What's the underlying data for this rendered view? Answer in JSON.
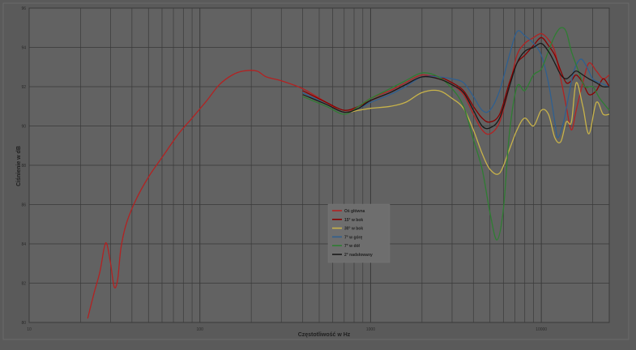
{
  "chart_data": {
    "type": "line",
    "xlabel": "Częstotliwość w Hz",
    "ylabel": "Ciśnienie w dB",
    "x_scale": "log",
    "xlim": [
      10,
      25000
    ],
    "ylim": [
      80,
      96
    ],
    "x_ticks": [
      10,
      100,
      1000,
      10000
    ],
    "x_tick_labels": [
      "10",
      "100",
      "1000",
      "10000"
    ],
    "y_ticks": [
      80,
      82,
      84,
      86,
      88,
      90,
      92,
      94,
      96
    ],
    "y_tick_labels": [
      "80",
      "82",
      "84",
      "86",
      "88",
      "90",
      "92",
      "94",
      "96"
    ],
    "grid": true,
    "legend_position": "center",
    "series": [
      {
        "name": "Oś główna",
        "color": "#b22222",
        "points": [
          [
            22,
            80.2
          ],
          [
            24,
            81.5
          ],
          [
            26,
            82.6
          ],
          [
            27.5,
            83.8
          ],
          [
            28.5,
            84.0
          ],
          [
            30,
            83.0
          ],
          [
            31.5,
            81.8
          ],
          [
            33,
            82.2
          ],
          [
            34.5,
            83.8
          ],
          [
            37,
            85.0
          ],
          [
            42,
            86.2
          ],
          [
            50,
            87.4
          ],
          [
            60,
            88.4
          ],
          [
            75,
            89.6
          ],
          [
            90,
            90.4
          ],
          [
            110,
            91.3
          ],
          [
            130,
            92.1
          ],
          [
            155,
            92.6
          ],
          [
            180,
            92.8
          ],
          [
            215,
            92.8
          ],
          [
            245,
            92.5
          ],
          [
            300,
            92.3
          ],
          [
            400,
            91.9
          ],
          [
            550,
            91.2
          ],
          [
            700,
            90.7
          ],
          [
            850,
            91.0
          ],
          [
            1000,
            91.4
          ],
          [
            1300,
            91.8
          ],
          [
            1600,
            92.2
          ],
          [
            2000,
            92.6
          ],
          [
            2500,
            92.4
          ],
          [
            3000,
            92.1
          ],
          [
            3500,
            91.6
          ],
          [
            4000,
            90.6
          ],
          [
            4500,
            89.8
          ],
          [
            5000,
            89.6
          ],
          [
            5700,
            90.2
          ],
          [
            6500,
            92.0
          ],
          [
            7200,
            93.6
          ],
          [
            8000,
            94.2
          ],
          [
            9000,
            94.5
          ],
          [
            10000,
            94.7
          ],
          [
            11000,
            94.4
          ],
          [
            12000,
            93.8
          ],
          [
            13000,
            92.4
          ],
          [
            14000,
            91.0
          ],
          [
            15000,
            89.8
          ],
          [
            16000,
            90.8
          ],
          [
            17500,
            92.2
          ],
          [
            19000,
            93.2
          ],
          [
            21000,
            92.8
          ],
          [
            23000,
            92.4
          ],
          [
            25000,
            92.6
          ]
        ]
      },
      {
        "name": "15° w bok",
        "color": "#8b0000",
        "points": [
          [
            400,
            91.8
          ],
          [
            550,
            91.2
          ],
          [
            700,
            90.8
          ],
          [
            850,
            91.0
          ],
          [
            1000,
            91.3
          ],
          [
            1300,
            91.7
          ],
          [
            1600,
            92.1
          ],
          [
            2000,
            92.5
          ],
          [
            2500,
            92.5
          ],
          [
            3000,
            92.2
          ],
          [
            3500,
            91.8
          ],
          [
            4000,
            91.0
          ],
          [
            4500,
            90.4
          ],
          [
            5000,
            90.2
          ],
          [
            5700,
            90.6
          ],
          [
            6500,
            92.2
          ],
          [
            7200,
            93.2
          ],
          [
            8000,
            93.6
          ],
          [
            9000,
            94.1
          ],
          [
            10000,
            94.5
          ],
          [
            11000,
            94.1
          ],
          [
            12000,
            93.6
          ],
          [
            13000,
            92.8
          ],
          [
            14000,
            92.2
          ],
          [
            15000,
            92.3
          ],
          [
            16000,
            92.6
          ],
          [
            17500,
            92.2
          ],
          [
            19000,
            91.6
          ],
          [
            21000,
            91.8
          ],
          [
            23000,
            92.4
          ],
          [
            25000,
            92.0
          ]
        ]
      },
      {
        "name": "30° w bok",
        "color": "#c8b34a",
        "points": [
          [
            400,
            91.6
          ],
          [
            550,
            91.1
          ],
          [
            700,
            90.7
          ],
          [
            850,
            90.8
          ],
          [
            1000,
            90.9
          ],
          [
            1300,
            91.0
          ],
          [
            1600,
            91.2
          ],
          [
            2000,
            91.7
          ],
          [
            2500,
            91.8
          ],
          [
            3000,
            91.4
          ],
          [
            3500,
            90.9
          ],
          [
            4000,
            89.8
          ],
          [
            4500,
            88.6
          ],
          [
            5000,
            87.8
          ],
          [
            5700,
            87.6
          ],
          [
            6500,
            88.8
          ],
          [
            7200,
            89.8
          ],
          [
            8000,
            90.4
          ],
          [
            9000,
            90.0
          ],
          [
            10000,
            90.8
          ],
          [
            11000,
            90.6
          ],
          [
            12000,
            89.4
          ],
          [
            13000,
            89.2
          ],
          [
            14000,
            90.2
          ],
          [
            15000,
            90.2
          ],
          [
            16000,
            92.2
          ],
          [
            17500,
            91.0
          ],
          [
            19000,
            89.6
          ],
          [
            21000,
            91.2
          ],
          [
            23000,
            90.6
          ],
          [
            25000,
            90.6
          ]
        ]
      },
      {
        "name": "7° w górę",
        "color": "#2f5f8f",
        "points": [
          [
            400,
            91.7
          ],
          [
            550,
            91.1
          ],
          [
            700,
            90.7
          ],
          [
            850,
            90.9
          ],
          [
            1000,
            91.2
          ],
          [
            1300,
            91.6
          ],
          [
            1600,
            92.0
          ],
          [
            2000,
            92.5
          ],
          [
            2500,
            92.5
          ],
          [
            3000,
            92.4
          ],
          [
            3500,
            92.2
          ],
          [
            4000,
            91.5
          ],
          [
            4500,
            90.8
          ],
          [
            5000,
            90.8
          ],
          [
            5700,
            91.8
          ],
          [
            6500,
            93.6
          ],
          [
            7200,
            94.8
          ],
          [
            8000,
            94.6
          ],
          [
            9000,
            94.2
          ],
          [
            10000,
            93.6
          ],
          [
            11000,
            92.2
          ],
          [
            12000,
            90.2
          ],
          [
            12500,
            89.4
          ],
          [
            13500,
            90.2
          ],
          [
            14500,
            91.6
          ],
          [
            15500,
            92.8
          ],
          [
            17000,
            93.4
          ],
          [
            18500,
            93.0
          ],
          [
            20000,
            92.4
          ],
          [
            22000,
            92.2
          ],
          [
            25000,
            92.0
          ]
        ]
      },
      {
        "name": "7° w dół",
        "color": "#2e7d32",
        "points": [
          [
            400,
            91.5
          ],
          [
            550,
            91.0
          ],
          [
            700,
            90.6
          ],
          [
            850,
            91.0
          ],
          [
            1000,
            91.4
          ],
          [
            1300,
            91.9
          ],
          [
            1600,
            92.3
          ],
          [
            2000,
            92.7
          ],
          [
            2500,
            92.5
          ],
          [
            3000,
            91.9
          ],
          [
            3500,
            91.0
          ],
          [
            4000,
            89.3
          ],
          [
            4500,
            87.8
          ],
          [
            5000,
            85.6
          ],
          [
            5500,
            84.2
          ],
          [
            6000,
            85.8
          ],
          [
            6500,
            89.6
          ],
          [
            7200,
            92.0
          ],
          [
            8000,
            91.8
          ],
          [
            9000,
            92.6
          ],
          [
            10000,
            92.9
          ],
          [
            11000,
            93.8
          ],
          [
            12000,
            94.6
          ],
          [
            13000,
            95.0
          ],
          [
            14000,
            94.8
          ],
          [
            15000,
            93.8
          ],
          [
            16500,
            92.8
          ],
          [
            18000,
            92.0
          ],
          [
            20000,
            92.0
          ],
          [
            22000,
            91.4
          ],
          [
            25000,
            90.8
          ]
        ]
      },
      {
        "name": "2° nadsłowany",
        "color": "#1a1a1a",
        "points": [
          [
            400,
            91.6
          ],
          [
            550,
            91.1
          ],
          [
            700,
            90.7
          ],
          [
            850,
            90.9
          ],
          [
            1000,
            91.3
          ],
          [
            1300,
            91.7
          ],
          [
            1600,
            92.1
          ],
          [
            2000,
            92.5
          ],
          [
            2500,
            92.4
          ],
          [
            3000,
            92.1
          ],
          [
            3500,
            91.7
          ],
          [
            4000,
            90.8
          ],
          [
            4500,
            90.0
          ],
          [
            5000,
            89.9
          ],
          [
            5700,
            90.4
          ],
          [
            6500,
            92.0
          ],
          [
            7200,
            93.2
          ],
          [
            8000,
            93.8
          ],
          [
            9000,
            94.0
          ],
          [
            10000,
            94.2
          ],
          [
            11000,
            93.8
          ],
          [
            12000,
            93.2
          ],
          [
            13000,
            92.6
          ],
          [
            14000,
            92.4
          ],
          [
            15000,
            92.6
          ],
          [
            16000,
            92.8
          ],
          [
            17500,
            92.6
          ],
          [
            19000,
            92.4
          ],
          [
            21000,
            92.2
          ],
          [
            23000,
            92.0
          ],
          [
            25000,
            92.0
          ]
        ]
      }
    ]
  }
}
